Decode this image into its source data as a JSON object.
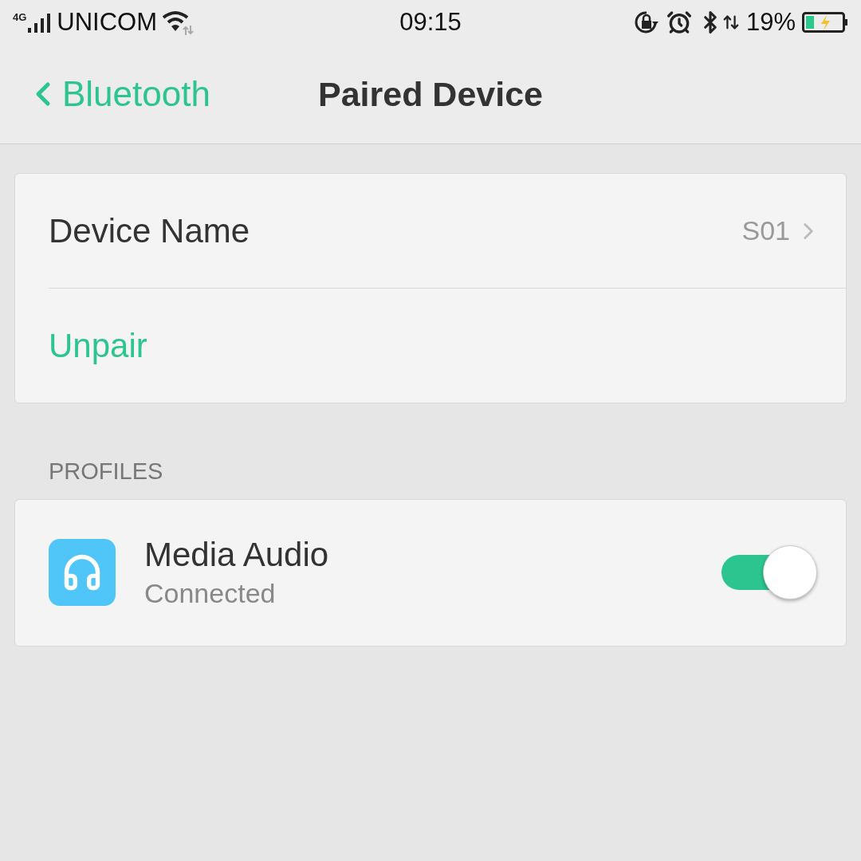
{
  "status_bar": {
    "network": "4G",
    "carrier": "UNICOM",
    "time": "09:15",
    "battery": "19%"
  },
  "header": {
    "back_label": "Bluetooth",
    "title": "Paired Device"
  },
  "device_card": {
    "name_label": "Device Name",
    "name_value": "S01",
    "unpair": "Unpair"
  },
  "profiles": {
    "heading": "PROFILES",
    "items": [
      {
        "name": "Media Audio",
        "status": "Connected",
        "on": true
      }
    ]
  }
}
